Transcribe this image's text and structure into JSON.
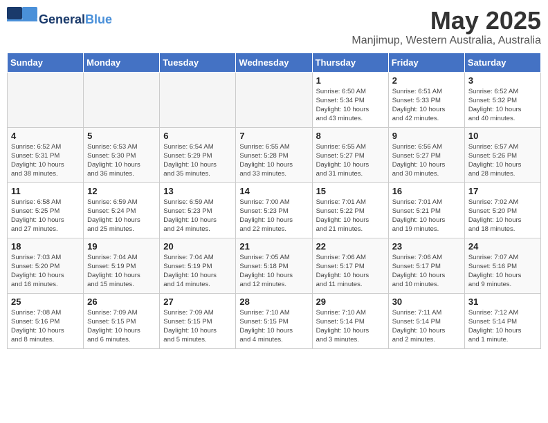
{
  "header": {
    "logo_general": "General",
    "logo_blue": "Blue",
    "month_title": "May 2025",
    "location": "Manjimup, Western Australia, Australia"
  },
  "weekdays": [
    "Sunday",
    "Monday",
    "Tuesday",
    "Wednesday",
    "Thursday",
    "Friday",
    "Saturday"
  ],
  "weeks": [
    [
      {
        "day": "",
        "info": ""
      },
      {
        "day": "",
        "info": ""
      },
      {
        "day": "",
        "info": ""
      },
      {
        "day": "",
        "info": ""
      },
      {
        "day": "1",
        "info": "Sunrise: 6:50 AM\nSunset: 5:34 PM\nDaylight: 10 hours\nand 43 minutes."
      },
      {
        "day": "2",
        "info": "Sunrise: 6:51 AM\nSunset: 5:33 PM\nDaylight: 10 hours\nand 42 minutes."
      },
      {
        "day": "3",
        "info": "Sunrise: 6:52 AM\nSunset: 5:32 PM\nDaylight: 10 hours\nand 40 minutes."
      }
    ],
    [
      {
        "day": "4",
        "info": "Sunrise: 6:52 AM\nSunset: 5:31 PM\nDaylight: 10 hours\nand 38 minutes."
      },
      {
        "day": "5",
        "info": "Sunrise: 6:53 AM\nSunset: 5:30 PM\nDaylight: 10 hours\nand 36 minutes."
      },
      {
        "day": "6",
        "info": "Sunrise: 6:54 AM\nSunset: 5:29 PM\nDaylight: 10 hours\nand 35 minutes."
      },
      {
        "day": "7",
        "info": "Sunrise: 6:55 AM\nSunset: 5:28 PM\nDaylight: 10 hours\nand 33 minutes."
      },
      {
        "day": "8",
        "info": "Sunrise: 6:55 AM\nSunset: 5:27 PM\nDaylight: 10 hours\nand 31 minutes."
      },
      {
        "day": "9",
        "info": "Sunrise: 6:56 AM\nSunset: 5:27 PM\nDaylight: 10 hours\nand 30 minutes."
      },
      {
        "day": "10",
        "info": "Sunrise: 6:57 AM\nSunset: 5:26 PM\nDaylight: 10 hours\nand 28 minutes."
      }
    ],
    [
      {
        "day": "11",
        "info": "Sunrise: 6:58 AM\nSunset: 5:25 PM\nDaylight: 10 hours\nand 27 minutes."
      },
      {
        "day": "12",
        "info": "Sunrise: 6:59 AM\nSunset: 5:24 PM\nDaylight: 10 hours\nand 25 minutes."
      },
      {
        "day": "13",
        "info": "Sunrise: 6:59 AM\nSunset: 5:23 PM\nDaylight: 10 hours\nand 24 minutes."
      },
      {
        "day": "14",
        "info": "Sunrise: 7:00 AM\nSunset: 5:23 PM\nDaylight: 10 hours\nand 22 minutes."
      },
      {
        "day": "15",
        "info": "Sunrise: 7:01 AM\nSunset: 5:22 PM\nDaylight: 10 hours\nand 21 minutes."
      },
      {
        "day": "16",
        "info": "Sunrise: 7:01 AM\nSunset: 5:21 PM\nDaylight: 10 hours\nand 19 minutes."
      },
      {
        "day": "17",
        "info": "Sunrise: 7:02 AM\nSunset: 5:20 PM\nDaylight: 10 hours\nand 18 minutes."
      }
    ],
    [
      {
        "day": "18",
        "info": "Sunrise: 7:03 AM\nSunset: 5:20 PM\nDaylight: 10 hours\nand 16 minutes."
      },
      {
        "day": "19",
        "info": "Sunrise: 7:04 AM\nSunset: 5:19 PM\nDaylight: 10 hours\nand 15 minutes."
      },
      {
        "day": "20",
        "info": "Sunrise: 7:04 AM\nSunset: 5:19 PM\nDaylight: 10 hours\nand 14 minutes."
      },
      {
        "day": "21",
        "info": "Sunrise: 7:05 AM\nSunset: 5:18 PM\nDaylight: 10 hours\nand 12 minutes."
      },
      {
        "day": "22",
        "info": "Sunrise: 7:06 AM\nSunset: 5:17 PM\nDaylight: 10 hours\nand 11 minutes."
      },
      {
        "day": "23",
        "info": "Sunrise: 7:06 AM\nSunset: 5:17 PM\nDaylight: 10 hours\nand 10 minutes."
      },
      {
        "day": "24",
        "info": "Sunrise: 7:07 AM\nSunset: 5:16 PM\nDaylight: 10 hours\nand 9 minutes."
      }
    ],
    [
      {
        "day": "25",
        "info": "Sunrise: 7:08 AM\nSunset: 5:16 PM\nDaylight: 10 hours\nand 8 minutes."
      },
      {
        "day": "26",
        "info": "Sunrise: 7:09 AM\nSunset: 5:15 PM\nDaylight: 10 hours\nand 6 minutes."
      },
      {
        "day": "27",
        "info": "Sunrise: 7:09 AM\nSunset: 5:15 PM\nDaylight: 10 hours\nand 5 minutes."
      },
      {
        "day": "28",
        "info": "Sunrise: 7:10 AM\nSunset: 5:15 PM\nDaylight: 10 hours\nand 4 minutes."
      },
      {
        "day": "29",
        "info": "Sunrise: 7:10 AM\nSunset: 5:14 PM\nDaylight: 10 hours\nand 3 minutes."
      },
      {
        "day": "30",
        "info": "Sunrise: 7:11 AM\nSunset: 5:14 PM\nDaylight: 10 hours\nand 2 minutes."
      },
      {
        "day": "31",
        "info": "Sunrise: 7:12 AM\nSunset: 5:14 PM\nDaylight: 10 hours\nand 1 minute."
      }
    ]
  ]
}
